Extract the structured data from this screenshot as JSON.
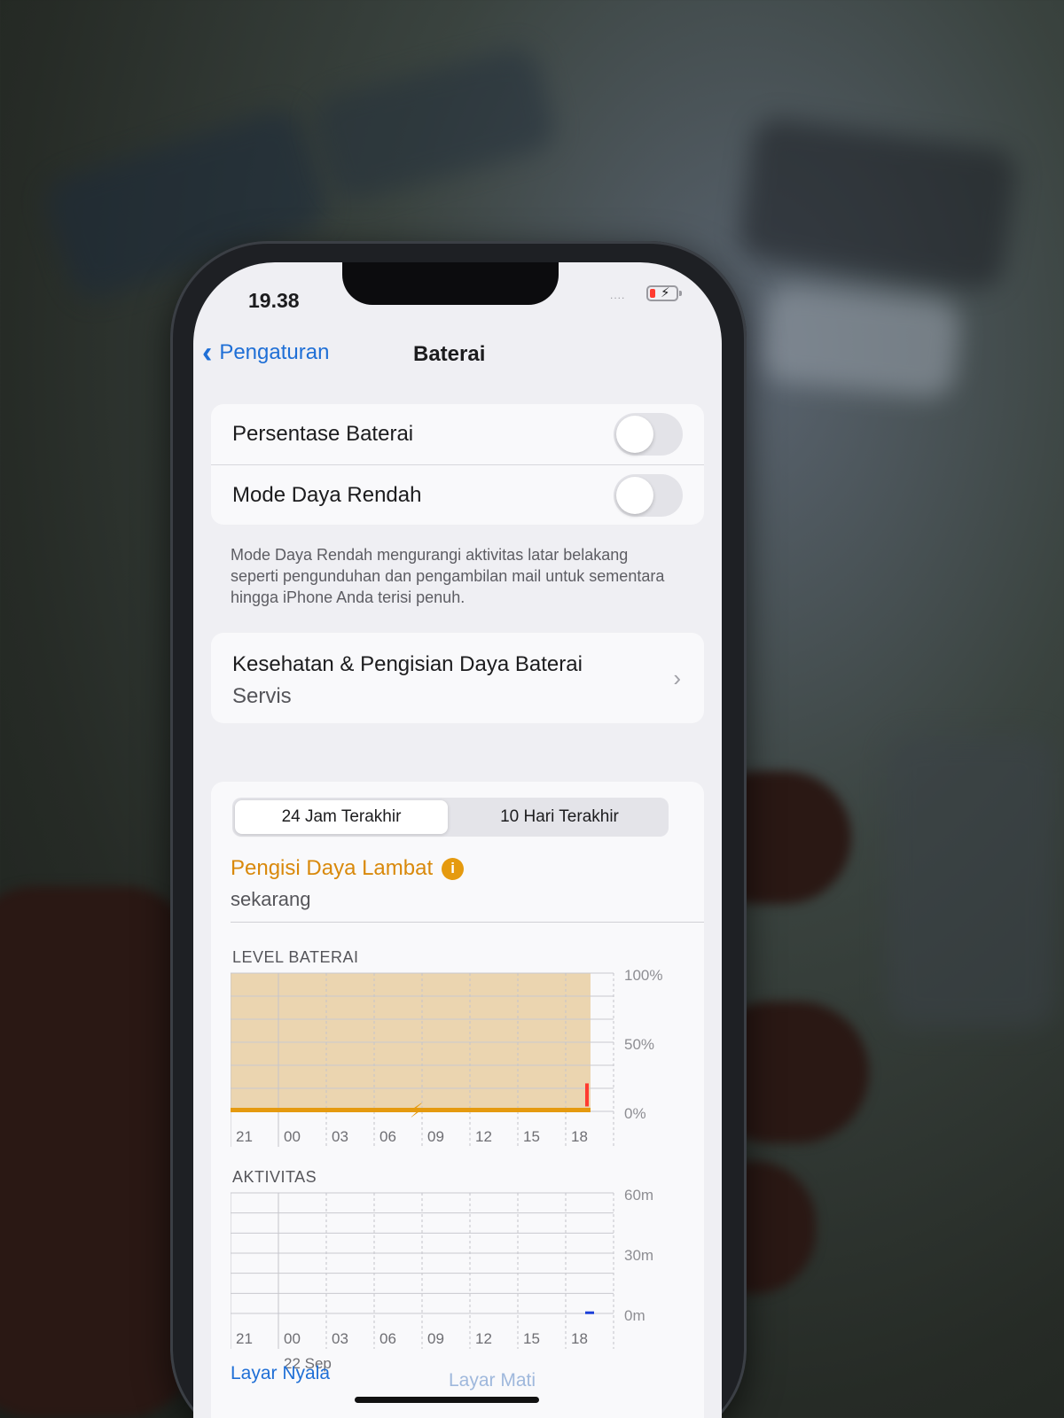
{
  "status_bar": {
    "time": "19.38",
    "signal_dots": "....",
    "battery_icon": "battery-charging-low-icon"
  },
  "nav": {
    "back_label": "Pengaturan",
    "title": "Baterai"
  },
  "settings": {
    "battery_percentage": {
      "label": "Persentase Baterai",
      "on": false
    },
    "low_power_mode": {
      "label": "Mode Daya Rendah",
      "on": false
    },
    "footnote": "Mode Daya Rendah mengurangi aktivitas latar belakang seperti pengunduhan dan pengambilan mail untuk sementara hingga iPhone Anda terisi penuh."
  },
  "health": {
    "title": "Kesehatan & Pengisian Daya Baterai",
    "status": "Servis"
  },
  "usage": {
    "tabs": [
      "24 Jam Terakhir",
      "10 Hari Terakhir"
    ],
    "active_tab": 0,
    "charger_title": "Pengisi Daya Lambat",
    "charger_time": "sekarang",
    "level_label": "LEVEL BATERAI",
    "activity_label": "AKTIVITAS",
    "activity_date": "22 Sep"
  },
  "bottom_links": [
    "Layar Nyala",
    "Layar Mati"
  ],
  "colors": {
    "accent_blue": "#1f6fd6",
    "charger_orange": "#e59a0f",
    "low_battery_red": "#ff3b30",
    "activity_blue": "#1a3fd8"
  },
  "chart_data": [
    {
      "type": "area",
      "title": "LEVEL BATERAI",
      "categories": [
        "21",
        "00",
        "03",
        "06",
        "09",
        "12",
        "15",
        "18"
      ],
      "y_tick_labels": [
        "100%",
        "50%",
        "0%"
      ],
      "ylim": [
        0,
        100
      ],
      "series": [
        {
          "values": [
            1,
            1,
            1,
            1,
            1,
            1,
            1,
            1
          ]
        }
      ],
      "charging_shaded": true,
      "charging_marker_at": "09",
      "grid": true
    },
    {
      "type": "bar",
      "title": "AKTIVITAS",
      "categories": [
        "21",
        "00",
        "03",
        "06",
        "09",
        "12",
        "15",
        "18"
      ],
      "y_tick_labels": [
        "60m",
        "30m",
        "0m"
      ],
      "ylim": [
        0,
        60
      ],
      "series": [
        {
          "values": [
            0,
            0,
            0,
            0,
            0,
            0,
            0,
            1
          ]
        }
      ],
      "grid": true
    }
  ]
}
